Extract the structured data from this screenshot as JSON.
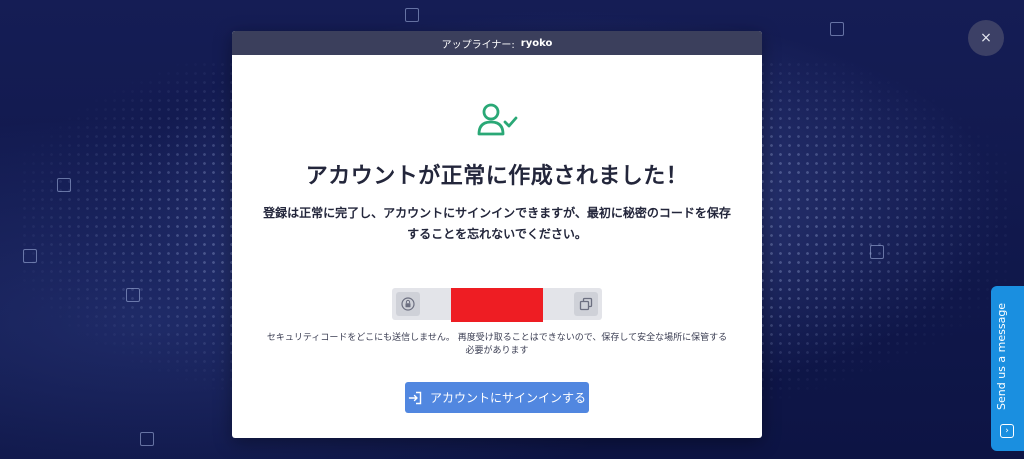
{
  "modal": {
    "header_label": "アップライナー:",
    "header_user": "ryoko",
    "title": "アカウントが正常に作成されました！",
    "description_line1": "登録は正常に完了し、アカウントにサインインできますが、最初に秘密のコードを保存",
    "description_line2": "することを忘れないでください。",
    "notice_line1": "セキュリティコードをどこにも送信しません。 再度受け取ることはできないので、保存して安全な場所に保管する",
    "notice_line2": "必要があります",
    "signin_button_label": "アカウントにサインインする",
    "icons": {
      "user": "user-check-icon",
      "lock": "lock-icon",
      "copy": "copy-icon",
      "signin": "sign-in-icon"
    }
  },
  "close_button": {
    "label": "×"
  },
  "chat_widget": {
    "label": "Send us a message"
  },
  "colors": {
    "accent": "#5187e0",
    "success_icon": "#2aa876",
    "header_bar": "#3b3f5c",
    "redaction": "#ee1d23",
    "chat_tab": "#1a8fe0"
  }
}
